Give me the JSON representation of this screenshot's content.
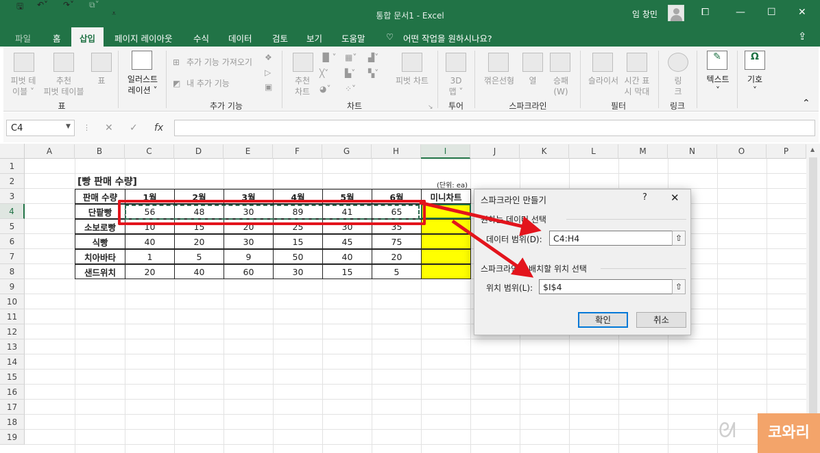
{
  "window": {
    "title": "통합 문서1  -  Excel",
    "user": "임 창민"
  },
  "ribbon_tabs": [
    "파일",
    "홈",
    "삽입",
    "페이지 레이아웃",
    "수식",
    "데이터",
    "검토",
    "보기",
    "도움말"
  ],
  "tell_me": "어떤 작업을 원하시나요?",
  "ribbon": {
    "pivot": "피벗 테\n이블 ˅",
    "rec_pivot": "추천\n피벗 테이블",
    "table": "표",
    "group_table": "표",
    "illustration": "일러스트\n레이션 ˅",
    "get_addins": "추가 기능 가져오기",
    "my_addins": "내 추가 기능",
    "group_addins": "추가 기능",
    "rec_charts": "추천\n차트",
    "pivot_chart": "피벗 차트",
    "group_charts": "차트",
    "map3d": "3D\n맵 ˅",
    "group_tour": "투어",
    "spark_line": "꺾은선형",
    "spark_col": "열",
    "spark_wl": "승패\n(W)",
    "group_spark": "스파크라인",
    "slicer": "슬라이서",
    "timeline": "시간 표\n시 막대",
    "group_filter": "필터",
    "link": "링\n크",
    "group_link": "링크",
    "text": "텍스트\n˅",
    "symbol": "기호\n˅"
  },
  "formula_bar": {
    "name_box": "C4",
    "fx": "fx",
    "cancel": "✕",
    "enter": "✓"
  },
  "columns": [
    "A",
    "B",
    "C",
    "D",
    "E",
    "F",
    "G",
    "H",
    "I",
    "J",
    "K",
    "L",
    "M",
    "N",
    "O",
    "P"
  ],
  "rows": [
    "1",
    "2",
    "3",
    "4",
    "5",
    "6",
    "7",
    "8",
    "9",
    "10",
    "11",
    "12",
    "13",
    "14",
    "15",
    "16",
    "17",
    "18",
    "19"
  ],
  "sheet": {
    "title": "[빵 판매 수량]",
    "unit_note": "(단위: ea)",
    "headers": [
      "판매 수량",
      "1월",
      "2월",
      "3월",
      "4월",
      "5월",
      "6월",
      "미니차트"
    ],
    "table": [
      {
        "name": "단팥빵",
        "values": [
          "56",
          "48",
          "30",
          "89",
          "41",
          "65"
        ]
      },
      {
        "name": "소보로빵",
        "values": [
          "10",
          "15",
          "20",
          "25",
          "30",
          "35"
        ]
      },
      {
        "name": "식빵",
        "values": [
          "40",
          "20",
          "30",
          "15",
          "45",
          "75"
        ]
      },
      {
        "name": "치아바타",
        "values": [
          "1",
          "5",
          "9",
          "50",
          "40",
          "20"
        ]
      },
      {
        "name": "샌드위치",
        "values": [
          "20",
          "40",
          "60",
          "30",
          "15",
          "5"
        ]
      }
    ]
  },
  "dialog": {
    "title": "스파크라인 만들기",
    "help": "?",
    "close": "✕",
    "section1": "원하는 데이터 선택",
    "data_range_label": "데이터 범위(D):",
    "data_range_value": "C4:H4",
    "section2": "스파크라인을 배치할 위치 선택",
    "location_label": "위치 범위(L):",
    "location_value": "$I$4",
    "ok": "확인",
    "cancel": "취소"
  },
  "watermark": "코와리",
  "colors": {
    "excel_green": "#217346",
    "highlight_yellow": "#ffff00",
    "annotation_red": "#e3141c"
  }
}
